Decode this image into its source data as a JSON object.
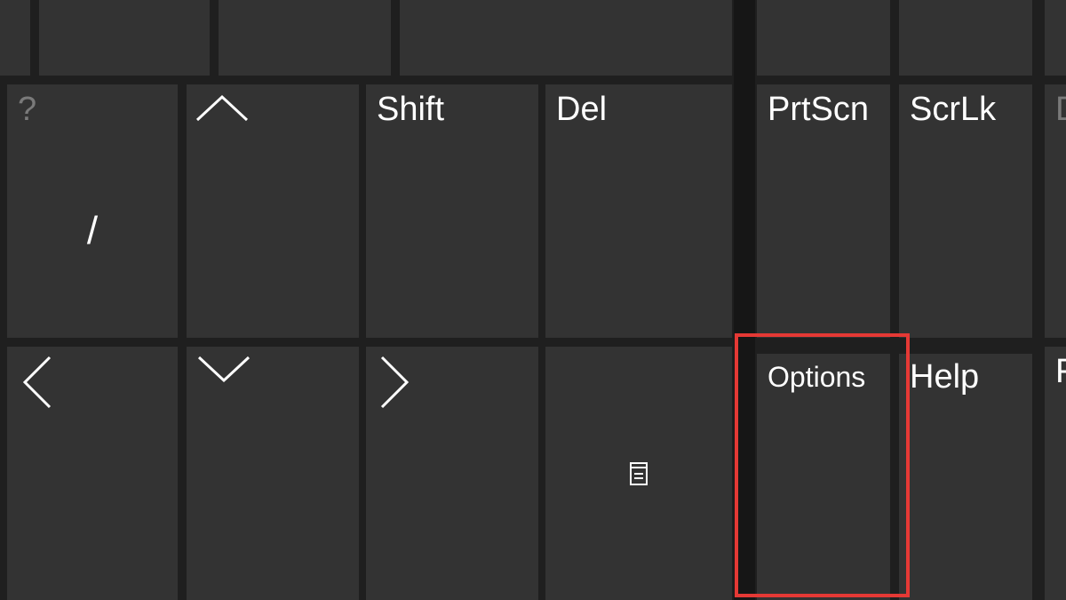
{
  "keyboard": {
    "row2": {
      "question_top": "?",
      "question_main": "/",
      "shift": "Shift",
      "del": "Del",
      "prtscn": "PrtScn",
      "scrlk": "ScrLk",
      "edge_partial": "D"
    },
    "row3": {
      "options": "Options",
      "help": "Help",
      "edge_partial": "F"
    },
    "icons": {
      "up": "caret-up-icon",
      "down": "caret-down-icon",
      "left": "caret-left-icon",
      "right": "caret-right-icon",
      "menu": "context-menu-icon"
    },
    "highlight_color": "#e53935"
  }
}
